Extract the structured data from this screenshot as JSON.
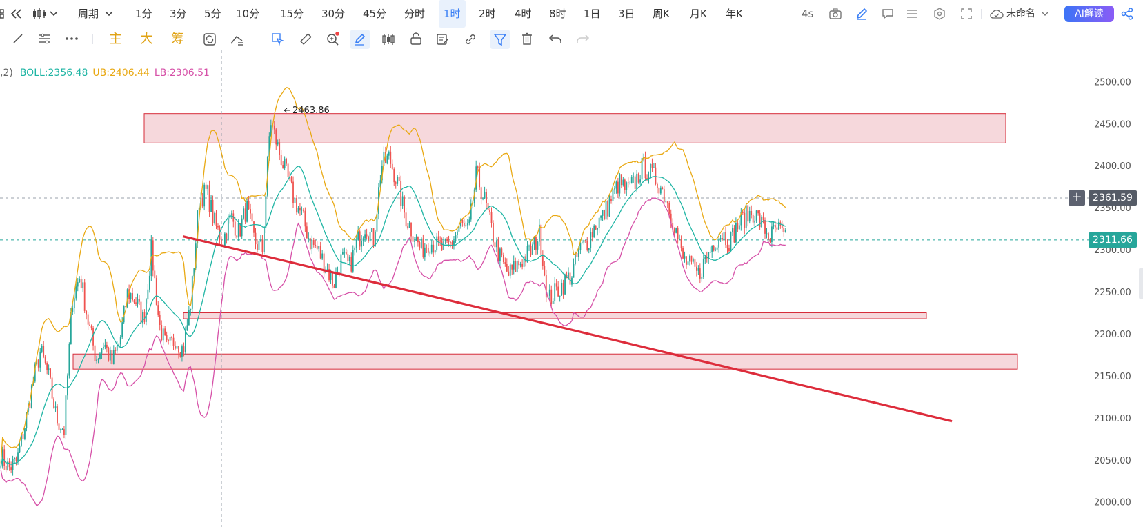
{
  "toolbar": {
    "period_label": "周期",
    "intervals": [
      "1分",
      "3分",
      "5分",
      "10分",
      "15分",
      "30分",
      "45分",
      "分时",
      "1时",
      "2时",
      "4时",
      "8时",
      "1日",
      "3日",
      "周K",
      "月K",
      "年K"
    ],
    "active_interval": "1时",
    "refresh": "4s",
    "save_name": "未命名",
    "ai_button": "AI解读"
  },
  "toolbar2": {
    "indicators": [
      "主",
      "大",
      "筹"
    ]
  },
  "legend": {
    "prefix": ",2)",
    "boll": "BOLL:2356.48",
    "ub": "UB:2406.44",
    "lb": "LB:2306.51"
  },
  "colors": {
    "boll": "#1fb5a4",
    "ub": "#e9a914",
    "lb": "#d651a8",
    "up": "#26a69a",
    "down": "#ef5350",
    "zone_fill": "#f3cbd0",
    "zone_stroke": "#d62b39",
    "trendline": "#dd2c3b",
    "accent": "#3a7ff5"
  },
  "price_axis": {
    "labels": [
      "2500.00",
      "2450.00",
      "2400.00",
      "2350.00",
      "2300.00",
      "2250.00",
      "2200.00",
      "2150.00",
      "2100.00",
      "2050.00",
      "2000.00"
    ]
  },
  "price_tags": {
    "crosshair": "2361.59",
    "last": "2311.66"
  },
  "chart_data": {
    "type": "candlestick",
    "y_range": [
      1985,
      2520
    ],
    "high_annotation": "2463.86",
    "zones": [
      {
        "from": 2427,
        "to": 2462
      },
      {
        "from": 2218,
        "to": 2225
      },
      {
        "from": 2158,
        "to": 2176
      }
    ],
    "trendline": {
      "from": 2316,
      "to": 2096
    },
    "horizontal_lines": [
      2361.59,
      2311.66
    ],
    "price_path": [
      2055,
      2040,
      2048,
      2090,
      2140,
      2180,
      2150,
      2100,
      2085,
      2240,
      2270,
      2215,
      2170,
      2190,
      2165,
      2190,
      2250,
      2240,
      2215,
      2300,
      2210,
      2180,
      2195,
      2180,
      2240,
      2360,
      2370,
      2330,
      2310,
      2340,
      2320,
      2350,
      2310,
      2300,
      2455,
      2420,
      2390,
      2360,
      2340,
      2310,
      2300,
      2280,
      2260,
      2290,
      2280,
      2310,
      2330,
      2310,
      2400,
      2410,
      2380,
      2340,
      2320,
      2300,
      2310,
      2305,
      2300,
      2310,
      2330,
      2320,
      2390,
      2360,
      2320,
      2290,
      2270,
      2280,
      2290,
      2300,
      2320,
      2240,
      2250,
      2260,
      2270,
      2300,
      2310,
      2330,
      2340,
      2360,
      2380,
      2370,
      2380,
      2400,
      2390,
      2380,
      2360,
      2330,
      2290,
      2280,
      2270,
      2290,
      2310,
      2320,
      2310,
      2330,
      2340,
      2345,
      2330,
      2315,
      2325,
      2311.66
    ]
  }
}
